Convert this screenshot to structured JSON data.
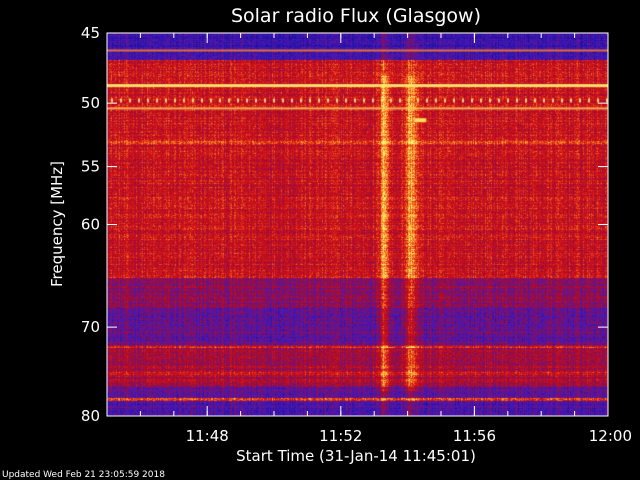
{
  "chart_data": {
    "type": "heatmap",
    "title": "Solar radio Flux (Glasgow)",
    "xlabel": "Start Time (31-Jan-14 11:45:01)",
    "ylabel": "Frequency [MHz]",
    "x_ticks": [
      "11:48",
      "11:52",
      "11:56",
      "12:00"
    ],
    "x_tick_minutes": [
      3,
      7,
      11,
      15
    ],
    "x_range_minutes": [
      0,
      15
    ],
    "y_ticks": [
      45,
      50,
      55,
      60,
      70,
      80
    ],
    "y_range_mhz": [
      45,
      80
    ],
    "y_scale": "log",
    "colormap": "blue-purple-red-yellow",
    "footer": "Updated Wed Feb 21 23:05:59 2018"
  },
  "colors": {
    "background": "#000000",
    "low": "#2a1fd6",
    "mid": "#c80a1e",
    "high": "#ffef6a",
    "axes": "#ffffff"
  }
}
